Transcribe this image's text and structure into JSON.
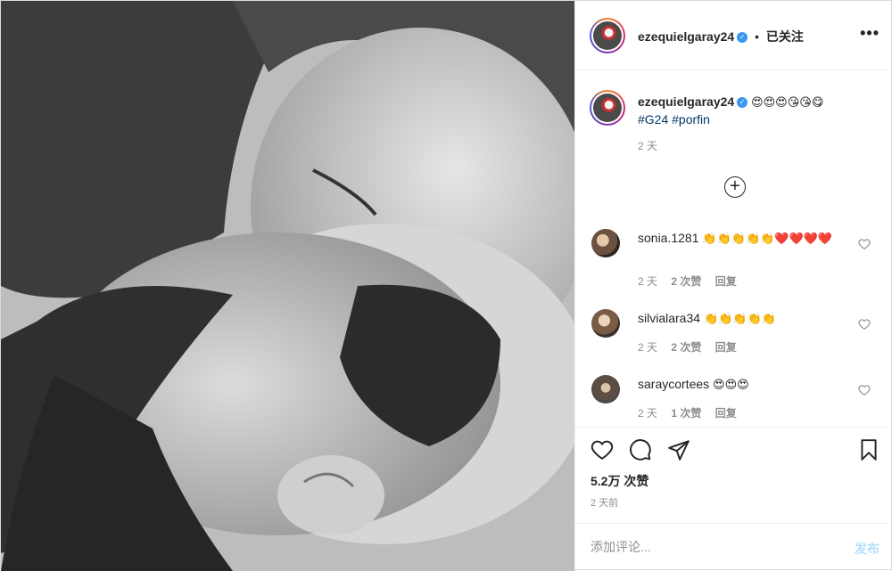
{
  "post": {
    "username": "ezequielgaray24",
    "follow_status": "已关注",
    "more_label": "•••",
    "caption_emojis": "😍😍😍😘😘😋",
    "hashtags": [
      "#G24",
      "#porfin"
    ],
    "caption_time": "2 天",
    "load_more_label": "+"
  },
  "comments": [
    {
      "username": "sonia.1281",
      "emojis": "👏👏👏👏👏❤️❤️❤️❤️",
      "time": "2 天",
      "likes": "2 次赞",
      "reply": "回复"
    },
    {
      "username": "silvialara34",
      "emojis": "👏👏👏👏👏",
      "time": "2 天",
      "likes": "2 次赞",
      "reply": "回复"
    },
    {
      "username": "saraycortees",
      "emojis": "😍😍😍",
      "time": "2 天",
      "likes": "1 次赞",
      "reply": "回复"
    }
  ],
  "actions": {
    "likes": "5.2万 次赞",
    "date": "2 天前"
  },
  "add_comment": {
    "placeholder": "添加评论...",
    "post_label": "发布"
  },
  "colors": {
    "accent": "#3897f0",
    "post_disabled": "#b2dffc",
    "hashtag": "#00376b"
  }
}
